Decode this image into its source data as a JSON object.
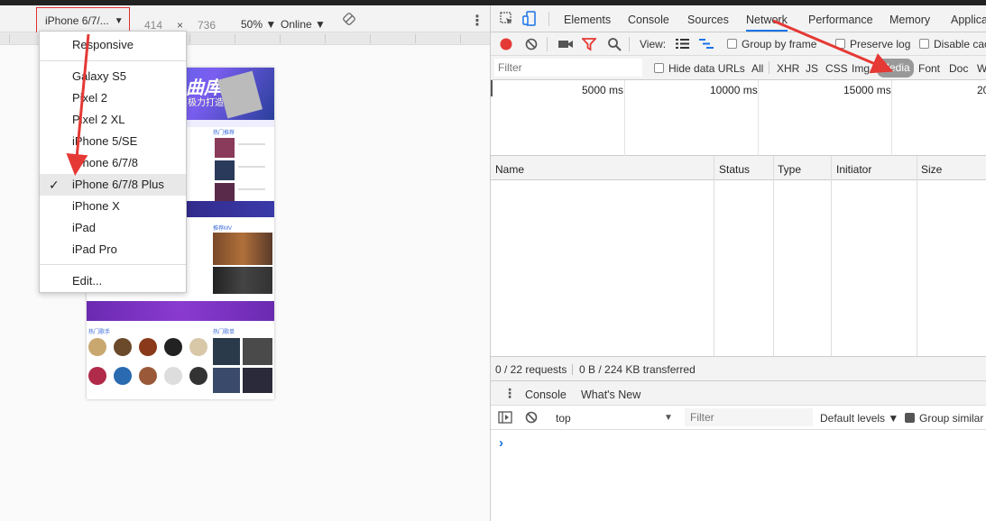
{
  "device_toolbar": {
    "device_label": "iPhone 6/7/...",
    "width": "414",
    "times": "×",
    "height": "736",
    "zoom": "50% ▼",
    "throttle": "Online ▼"
  },
  "device_menu": {
    "items": [
      "Responsive",
      "Galaxy S5",
      "Pixel 2",
      "Pixel 2 XL",
      "iPhone 5/SE",
      "iPhone 6/7/8",
      "iPhone 6/7/8 Plus",
      "iPhone X",
      "iPad",
      "iPad Pro",
      "Edit..."
    ],
    "selected": "iPhone 6/7/8 Plus"
  },
  "phone_preview": {
    "banner_logo": "曲库",
    "banner_sub": "极力打造",
    "section_hot": "热门推荐",
    "section_mv": "推荐MV",
    "section_singers": "热门歌手",
    "section_songs": "热门歌单"
  },
  "devtools": {
    "tabs": [
      "Elements",
      "Console",
      "Sources",
      "Network",
      "Performance",
      "Memory",
      "Applica"
    ],
    "active_tab": "Network",
    "view_label": "View:",
    "group_by_frame": "Group by frame",
    "preserve_log": "Preserve log",
    "disable_cache": "Disable cac",
    "filter_placeholder": "Filter",
    "hide_data_urls": "Hide data URLs",
    "filter_types": [
      "All",
      "XHR",
      "JS",
      "CSS",
      "Img",
      "Media",
      "Font",
      "Doc",
      "W"
    ],
    "active_filter": "Media",
    "timeline_labels": [
      "5000 ms",
      "10000 ms",
      "15000 ms",
      "20"
    ],
    "columns": [
      "Name",
      "Status",
      "Type",
      "Initiator",
      "Size"
    ],
    "requests_summary": "0 / 22 requests",
    "transferred_summary": "0 B / 224 KB transferred",
    "drawer_tabs": [
      "Console",
      "What's New"
    ],
    "context": "top",
    "console_filter_placeholder": "Filter",
    "levels": "Default levels ▼",
    "group_similar": "Group similar",
    "prompt": "›"
  },
  "colors": {
    "highlight_box": "#e03030",
    "arrow": "#e53935",
    "record": "#e53935",
    "filter_icon": "#e53935",
    "media_pill": "#999999",
    "active_tab_underline": "#1a73e8"
  }
}
